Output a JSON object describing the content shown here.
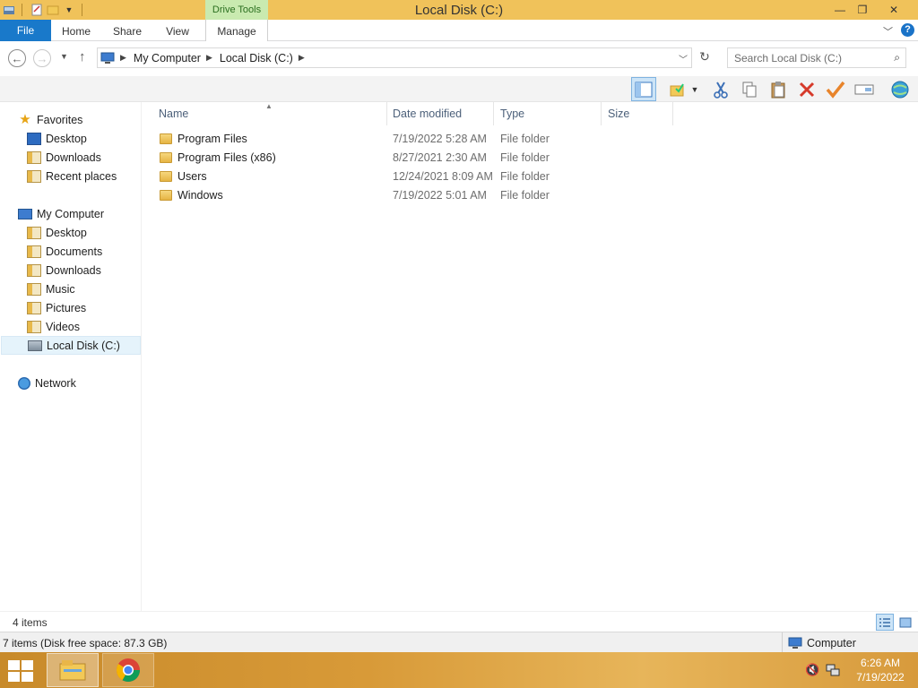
{
  "window": {
    "title": "Local Disk (C:)",
    "contextual_tab": "Drive Tools"
  },
  "ribbon": {
    "tabs": [
      {
        "label": "File"
      },
      {
        "label": "Home"
      },
      {
        "label": "Share"
      },
      {
        "label": "View"
      },
      {
        "label": "Manage"
      }
    ],
    "help": "?"
  },
  "address_bar": {
    "segments": [
      "My Computer",
      "Local Disk (C:)"
    ]
  },
  "search": {
    "placeholder": "Search Local Disk (C:)"
  },
  "navigation": {
    "favorites": {
      "label": "Favorites",
      "items": [
        "Desktop",
        "Downloads",
        "Recent places"
      ]
    },
    "computer": {
      "label": "My Computer",
      "items": [
        "Desktop",
        "Documents",
        "Downloads",
        "Music",
        "Pictures",
        "Videos",
        "Local Disk (C:)"
      ],
      "selected": "Local Disk (C:)"
    },
    "network": {
      "label": "Network"
    }
  },
  "file_list": {
    "columns": [
      "Name",
      "Date modified",
      "Type",
      "Size"
    ],
    "rows": [
      {
        "name": "Program Files",
        "date": "7/19/2022 5:28 AM",
        "type": "File folder"
      },
      {
        "name": "Program Files (x86)",
        "date": "8/27/2021 2:30 AM",
        "type": "File folder"
      },
      {
        "name": "Users",
        "date": "12/24/2021 8:09 AM",
        "type": "File folder"
      },
      {
        "name": "Windows",
        "date": "7/19/2022 5:01 AM",
        "type": "File folder"
      }
    ]
  },
  "status": {
    "item_count": "4 items",
    "details": "7 items (Disk free space: 87.3 GB)",
    "zone": "Computer"
  },
  "taskbar": {
    "time": "6:26 AM",
    "date": "7/19/2022"
  },
  "icons": {
    "toolbar": [
      "preview-pane-icon",
      "folder-options-icon",
      "cut-icon",
      "copy-icon",
      "paste-icon",
      "delete-icon",
      "checkmark-icon",
      "rename-icon",
      "globe-icon"
    ]
  },
  "colors": {
    "title_bar": "#f0c25a",
    "file_tab": "#1979ca",
    "drive_tools": "#c9eab0",
    "selection": "#e5f3fb"
  }
}
